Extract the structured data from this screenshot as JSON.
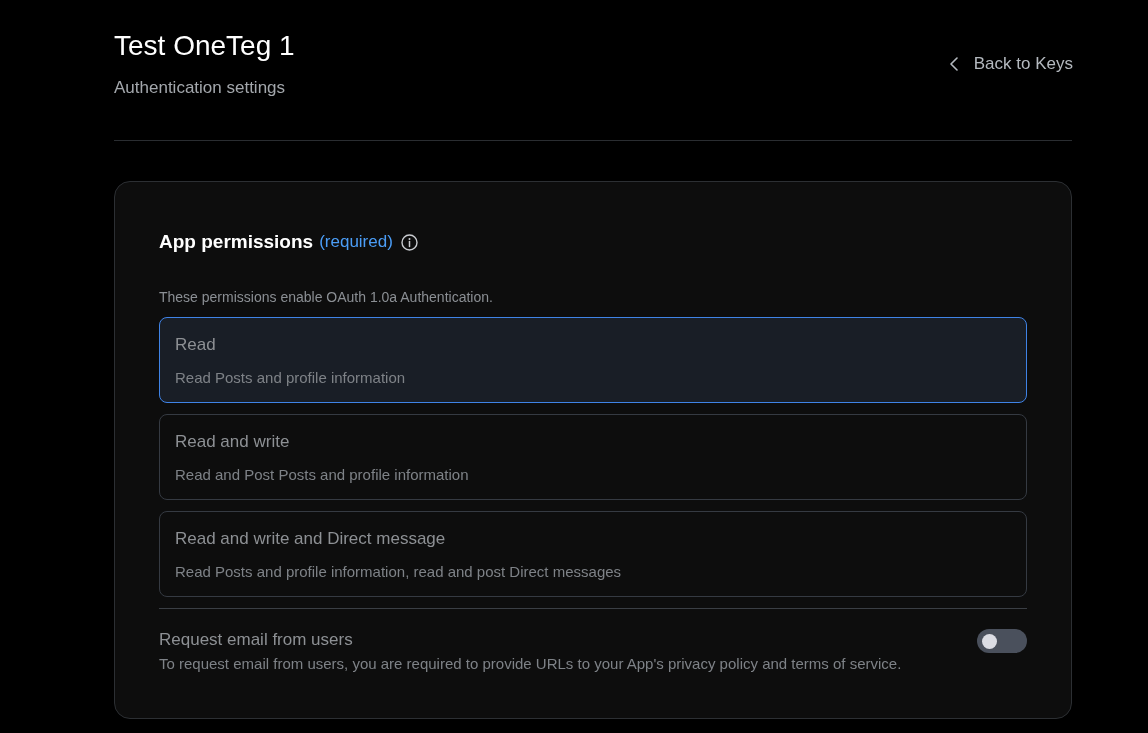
{
  "header": {
    "title": "Test OneTeg 1",
    "subtitle": "Authentication settings",
    "back_link": "Back to Keys"
  },
  "permissions": {
    "title": "App permissions",
    "required_label": "(required)",
    "description": "These permissions enable OAuth 1.0a Authentication.",
    "options": [
      {
        "title": "Read",
        "description": "Read Posts and profile information",
        "selected": true
      },
      {
        "title": "Read and write",
        "description": "Read and Post Posts and profile information",
        "selected": false
      },
      {
        "title": "Read and write and Direct message",
        "description": "Read Posts and profile information, read and post Direct messages",
        "selected": false
      }
    ]
  },
  "email_request": {
    "title": "Request email from users",
    "description": "To request email from users, you are required to provide URLs to your App's privacy policy and terms of service.",
    "on": false
  }
}
